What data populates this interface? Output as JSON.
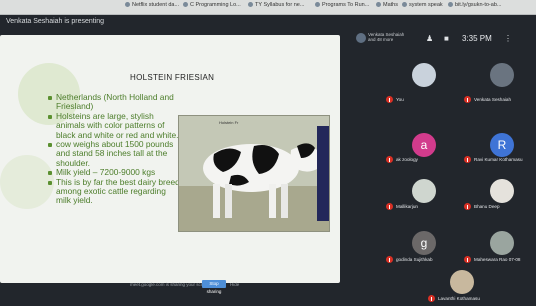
{
  "bookmarks": [
    {
      "label": "Netflix student da..."
    },
    {
      "label": "C Programming Lo..."
    },
    {
      "label": "TY Syllabus for ne..."
    },
    {
      "label": "Programs To Run..."
    },
    {
      "label": "Maths"
    },
    {
      "label": "system speak"
    },
    {
      "label": "bit.ly/gsukn-to-ab..."
    }
  ],
  "meet": {
    "presenter_label": "Venkata Seshaiah is presenting",
    "presentation_chip": "Venkata Seshaiah and 48 more",
    "time": "3:35 PM"
  },
  "slide": {
    "title": "HOLSTEIN FRIESIAN",
    "bullets": [
      "Netherlands (North Holland and Friesland)",
      "Holsteins are large, stylish animals with color patterns of black and white or red and white.",
      "cow weighs about 1500 pounds and stand 58 inches tall at the shoulder.",
      "Milk yield – 7200-9000 kgs",
      "This is by far the best dairy breed among exotic cattle regarding milk yield."
    ],
    "image_tag": "Holstein Fr",
    "sharing_bar": {
      "text": "meet.google.com is sharing your screen.",
      "stop_label": "Stop sharing",
      "hide_label": "Hide"
    }
  },
  "participants": [
    {
      "name": "You",
      "initial": "",
      "color": "#c9d2dc"
    },
    {
      "name": "Venkata Seshaiah",
      "initial": "",
      "color": "#6a7480"
    },
    {
      "name": "ak zoology",
      "initial": "a",
      "color": "#d23b8c"
    },
    {
      "name": "Ravi Kumar Kothamasu",
      "initial": "R",
      "color": "#3f74d6"
    },
    {
      "name": "Mallikarjun",
      "initial": "",
      "color": "#cfd6cf"
    },
    {
      "name": "Bhanu Deep",
      "initial": "",
      "color": "#e5e2dc"
    },
    {
      "name": "godinda Sujithkab",
      "initial": "g",
      "color": "#6b6868"
    },
    {
      "name": "Maheswara Rao 07-08",
      "initial": "",
      "color": "#9aa59f"
    },
    {
      "name": "Lavanthi Kothamasu",
      "initial": "",
      "color": "#c8b89e"
    }
  ]
}
